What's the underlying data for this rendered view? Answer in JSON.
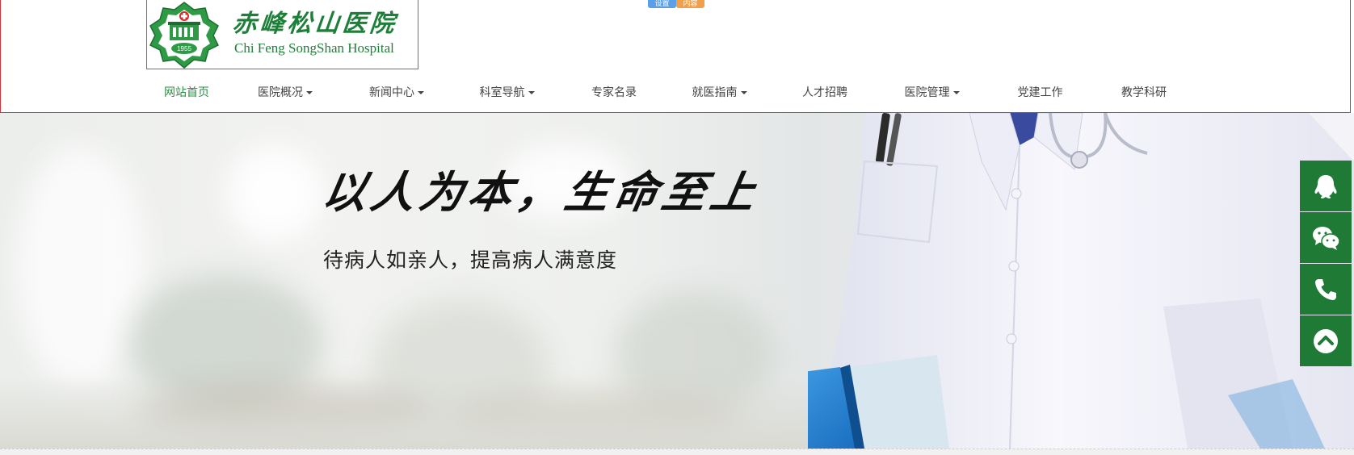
{
  "header": {
    "logo": {
      "name_cn": "赤峰松山医院",
      "name_en": "Chi Feng SongShan Hospital",
      "badge_year": "1955"
    },
    "lang_switch": [
      {
        "label": "设置",
        "color": "#5aa0e8"
      },
      {
        "label": "内容",
        "color": "#f0a04b"
      }
    ],
    "nav": [
      {
        "label": "网站首页",
        "dropdown": false,
        "active": true
      },
      {
        "label": "医院概况",
        "dropdown": true,
        "active": false
      },
      {
        "label": "新闻中心",
        "dropdown": true,
        "active": false
      },
      {
        "label": "科室导航",
        "dropdown": true,
        "active": false
      },
      {
        "label": "专家名录",
        "dropdown": false,
        "active": false
      },
      {
        "label": "就医指南",
        "dropdown": true,
        "active": false
      },
      {
        "label": "人才招聘",
        "dropdown": false,
        "active": false
      },
      {
        "label": "医院管理",
        "dropdown": true,
        "active": false
      },
      {
        "label": "党建工作",
        "dropdown": false,
        "active": false
      },
      {
        "label": "教学科研",
        "dropdown": false,
        "active": false
      }
    ]
  },
  "banner": {
    "slogan": "以人为本，生命至上",
    "subtitle": "待病人如亲人，提高病人满意度"
  },
  "side_bar": {
    "buttons": [
      {
        "icon": "qq-icon"
      },
      {
        "icon": "wechat-icon"
      },
      {
        "icon": "phone-icon"
      },
      {
        "icon": "back-to-top-icon"
      }
    ]
  },
  "colors": {
    "brand_green": "#1f7a35",
    "nav_active": "#2e8b43",
    "header_border": "#d9343a"
  }
}
